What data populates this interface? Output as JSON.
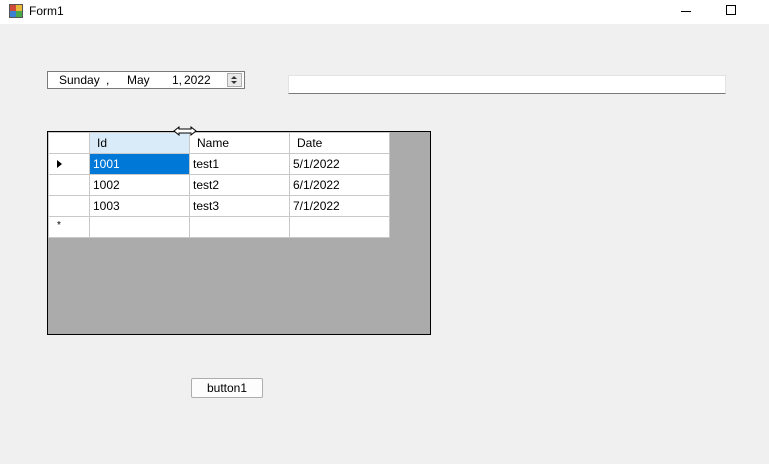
{
  "window": {
    "title": "Form1",
    "minimize_icon": "minimize-icon",
    "maximize_icon": "maximize-icon"
  },
  "datepicker": {
    "weekday": "Sunday",
    "separator": ",",
    "month": "May",
    "day": "1,",
    "year": "2022",
    "spinner_icon": "spin-updown-icon"
  },
  "textbox": {
    "value": ""
  },
  "grid": {
    "columns": [
      "Id",
      "Name",
      "Date"
    ],
    "rows": [
      {
        "id": "1001",
        "name": "test1",
        "date": "5/1/2022"
      },
      {
        "id": "1002",
        "name": "test2",
        "date": "6/1/2022"
      },
      {
        "id": "1003",
        "name": "test3",
        "date": "7/1/2022"
      }
    ],
    "new_row_marker": "*",
    "selected_header_color": "#d9ebf9",
    "selection_color": "#0078d7",
    "background_color": "#ababab"
  },
  "button1": {
    "label": "button1"
  }
}
